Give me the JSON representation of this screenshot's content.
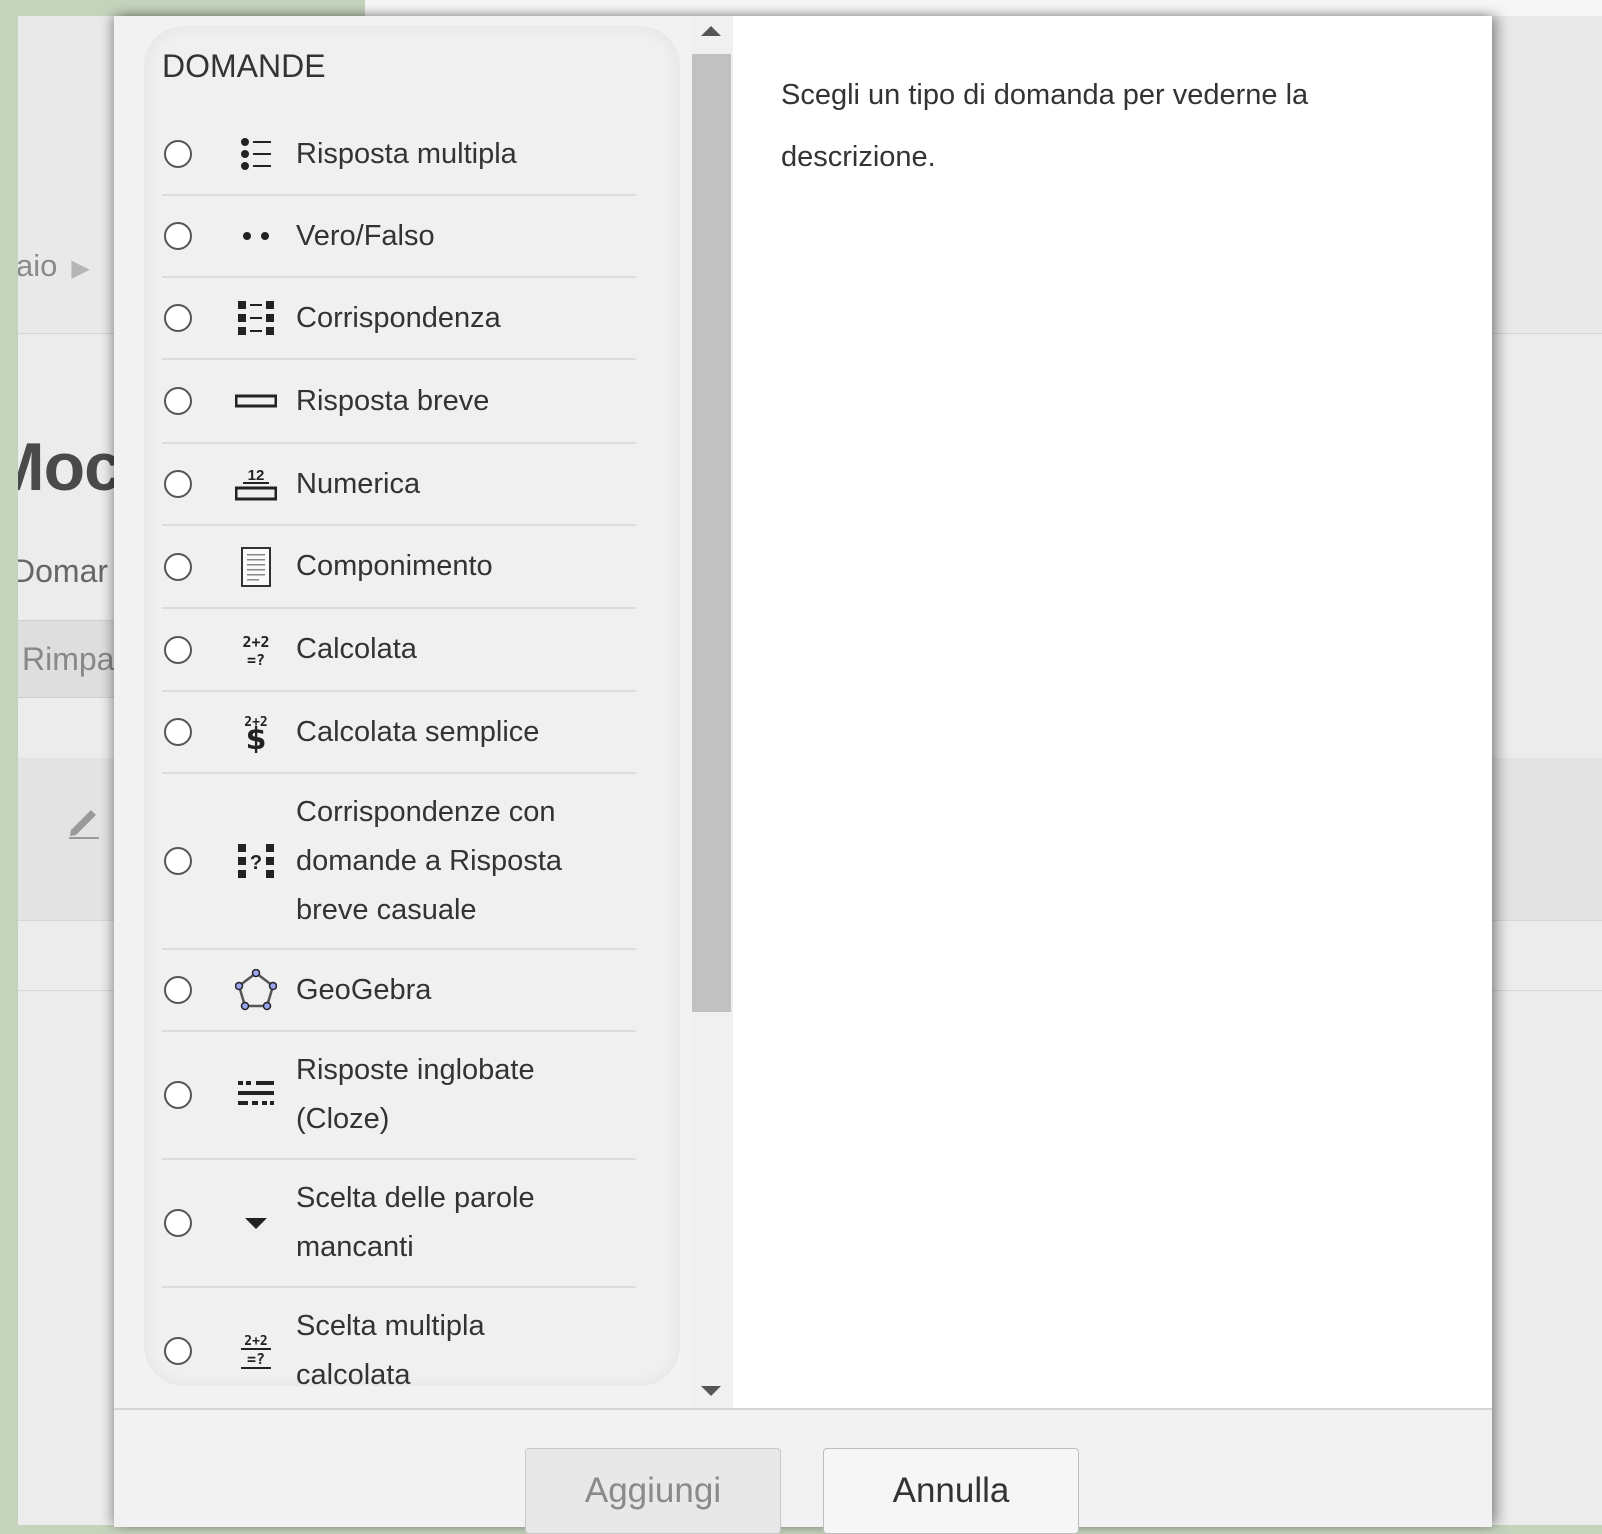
{
  "background": {
    "breadcrumb": "aio",
    "heading": "Moc",
    "subtitle": "Domar",
    "tab_label": "Rimpa"
  },
  "modal": {
    "section_title": "DOMANDE",
    "options": [
      {
        "label": "Risposta multipla",
        "icon": "multichoice-icon"
      },
      {
        "label": "Vero/Falso",
        "icon": "truefalse-icon"
      },
      {
        "label": "Corrispondenza",
        "icon": "match-icon"
      },
      {
        "label": "Risposta breve",
        "icon": "shortanswer-icon"
      },
      {
        "label": "Numerica",
        "icon": "numerical-icon"
      },
      {
        "label": "Componimento",
        "icon": "essay-icon"
      },
      {
        "label": "Calcolata",
        "icon": "calculated-icon"
      },
      {
        "label": "Calcolata semplice",
        "icon": "calculated-simple-icon"
      },
      {
        "label": "Corrispondenze con domande a Risposta breve casuale",
        "icon": "random-match-icon"
      },
      {
        "label": "GeoGebra",
        "icon": "geogebra-icon"
      },
      {
        "label": "Risposte inglobate (Cloze)",
        "icon": "cloze-icon"
      },
      {
        "label": "Scelta delle parole mancanti",
        "icon": "gapselect-icon"
      },
      {
        "label": "Scelta multipla calcolata",
        "icon": "calculated-multichoice-icon"
      }
    ],
    "description": "Scegli un tipo di domanda per vederne la descrizione.",
    "buttons": {
      "add": "Aggiungi",
      "cancel": "Annulla"
    }
  }
}
